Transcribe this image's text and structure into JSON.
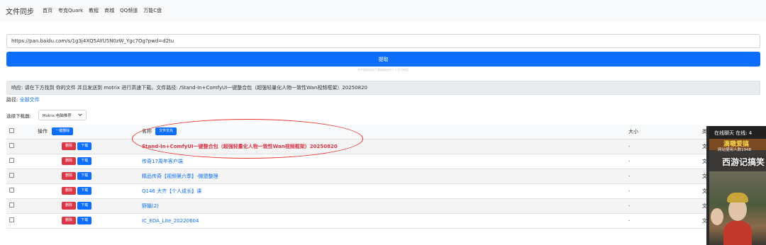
{
  "nav": {
    "brand": "文件同步",
    "links": [
      "首页",
      "夸克Quark",
      "教程",
      "商城",
      "QQ频道",
      "万能C盘"
    ]
  },
  "url_input": {
    "value": "https://pan.baidu.com/s/1g3j4XQ5AYU5N0zW_Ygc7Og?pwd=d2tu"
  },
  "extract_button": "提取",
  "hint_text": "文件提取后的下载链接仅供个人学习使用",
  "response_text": "响应: 请在下方找到 你的文件 并且发送到 motrix 进行高速下载。文件路径: /Stand-In+ComfyUI一键整合包（超强轻量化人物一致性Wan视频框架）20250820",
  "path": {
    "label": "路径:",
    "link": "全部文件"
  },
  "downloader": {
    "label": "选择下载器:",
    "selected": "Motrix 电脑推荐"
  },
  "table": {
    "headers": {
      "action": "操作",
      "delete_all": "一键删除",
      "name": "名称",
      "file_first": "文件优先",
      "size": "大小",
      "type_partial": "类"
    },
    "row_delete": "删除",
    "row_download": "下载",
    "rows": [
      {
        "name": "Stand-In+ComfyUI一键整合包（超强轻量化人物一致性Wan视频框架）20250820",
        "size": "-",
        "type": "文"
      },
      {
        "name": "传奇17周年客户端",
        "size": "-",
        "type": "文"
      },
      {
        "name": "精品传奇【视频第六季】-微盟整理",
        "size": "-",
        "type": "文"
      },
      {
        "name": "Q146 大齐【个人成长】课",
        "size": "-",
        "type": "文"
      },
      {
        "name": "野猫(2)",
        "size": "-",
        "type": "文"
      },
      {
        "name": "IC_EDA_Lite_20220604",
        "size": "-",
        "type": "文"
      }
    ]
  },
  "live_widget": {
    "header": "在线聊天 在线: 4",
    "banner": "滴嗷爱搞",
    "sub": "网站使用人数1948",
    "title": "西游记搞笑"
  },
  "colors": {
    "primary": "#0d6efd",
    "danger": "#dc3545",
    "annotation": "#e3342f"
  }
}
